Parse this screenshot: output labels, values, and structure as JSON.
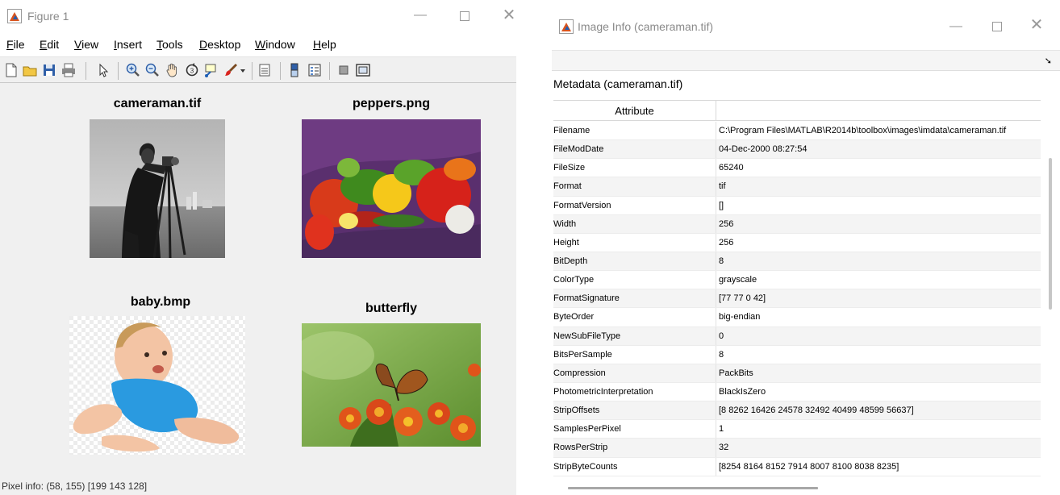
{
  "figure_window": {
    "title": "Figure 1",
    "controls": {
      "minimize": "—",
      "close": "✕"
    },
    "menu": [
      "File",
      "Edit",
      "View",
      "Insert",
      "Tools",
      "Desktop",
      "Window",
      "Help"
    ],
    "toolbar_icons": [
      "new-figure-icon",
      "open-file-icon",
      "save-icon",
      "print-icon",
      "edit-plot-arrow-icon",
      "zoom-in-icon",
      "zoom-out-icon",
      "pan-hand-icon",
      "rotate-3d-icon",
      "data-cursor-icon",
      "brush-icon",
      "brush-dropdown-icon",
      "link-plot-icon",
      "insert-colorbar-icon",
      "insert-legend-icon",
      "hide-plot-tools-icon",
      "show-plot-tools-icon"
    ],
    "images": [
      {
        "title": "cameraman.tif"
      },
      {
        "title": "peppers.png"
      },
      {
        "title": "baby.bmp"
      },
      {
        "title": "butterfly"
      }
    ],
    "status": "Pixel info: (58, 155)  [199 143 128]"
  },
  "info_window": {
    "title": "Image Info (cameraman.tif)",
    "controls": {
      "minimize": "—",
      "close": "✕"
    },
    "metadata_header": "Metadata (cameraman.tif)",
    "table_header": {
      "attribute": "Attribute",
      "value": ""
    },
    "rows": [
      {
        "attr": "Filename",
        "value": "C:\\Program Files\\MATLAB\\R2014b\\toolbox\\images\\imdata\\cameraman.tif"
      },
      {
        "attr": "FileModDate",
        "value": "04-Dec-2000 08:27:54"
      },
      {
        "attr": "FileSize",
        "value": "65240"
      },
      {
        "attr": "Format",
        "value": "tif"
      },
      {
        "attr": "FormatVersion",
        "value": "[]"
      },
      {
        "attr": "Width",
        "value": "256"
      },
      {
        "attr": "Height",
        "value": "256"
      },
      {
        "attr": "BitDepth",
        "value": "8"
      },
      {
        "attr": "ColorType",
        "value": "grayscale"
      },
      {
        "attr": "FormatSignature",
        "value": "[77 77 0 42]"
      },
      {
        "attr": "ByteOrder",
        "value": "big-endian"
      },
      {
        "attr": "NewSubFileType",
        "value": "0"
      },
      {
        "attr": "BitsPerSample",
        "value": "8"
      },
      {
        "attr": "Compression",
        "value": "PackBits"
      },
      {
        "attr": "PhotometricInterpretation",
        "value": "BlackIsZero"
      },
      {
        "attr": "StripOffsets",
        "value": "[8 8262 16426 24578 32492 40499 48599 56637]"
      },
      {
        "attr": "SamplesPerPixel",
        "value": "1"
      },
      {
        "attr": "RowsPerStrip",
        "value": "32"
      },
      {
        "attr": "StripByteCounts",
        "value": "[8254 8164 8152 7914 8007 8100 8038 8235]"
      }
    ]
  }
}
